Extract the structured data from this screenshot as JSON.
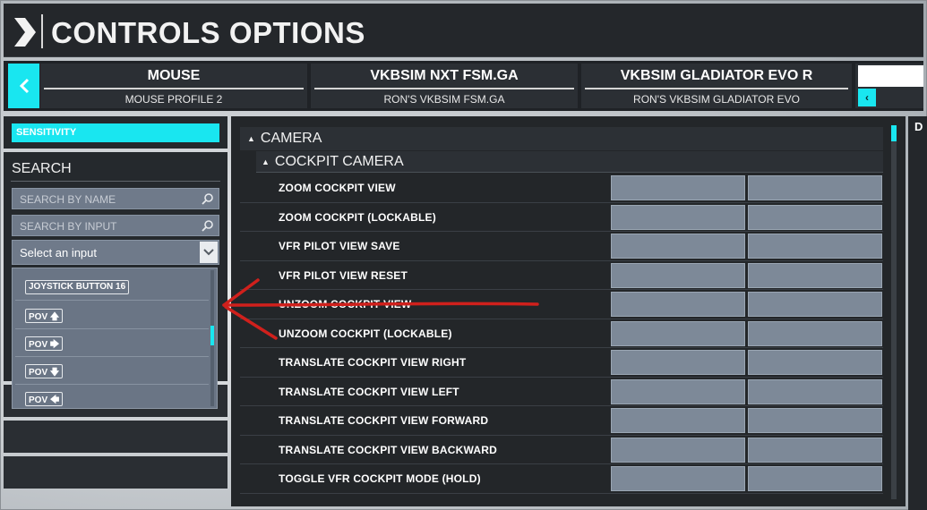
{
  "header": {
    "title": "CONTROLS OPTIONS",
    "back_icon": "chevron-right-icon"
  },
  "devices": [
    {
      "name": "MOUSE",
      "profile": "MOUSE PROFILE 2"
    },
    {
      "name": "VKBSIM NXT FSM.GA",
      "profile": "RON'S VKBSIM FSM.GA"
    },
    {
      "name": "VKBSIM GLADIATOR EVO R",
      "profile": "RON'S VKBSIM GLADIATOR EVO"
    }
  ],
  "devbar": {
    "prev_icon": "chevron-left-icon"
  },
  "left": {
    "sensitivity_label": "SENSITIVITY",
    "search_label": "SEARCH",
    "search_by_name_placeholder": "SEARCH BY NAME",
    "search_by_input_placeholder": "SEARCH BY INPUT",
    "select_input_value": "Select an input"
  },
  "dropdown": {
    "items": [
      {
        "label": "JOYSTICK BUTTON 16"
      },
      {
        "label": "POV 🡅"
      },
      {
        "label": "POV 🡆"
      },
      {
        "label": "POV 🡇"
      },
      {
        "label": "POV 🡄"
      }
    ]
  },
  "main": {
    "category": "CAMERA",
    "subcategory": "COCKPIT CAMERA",
    "rows": [
      {
        "label": "ZOOM COCKPIT VIEW"
      },
      {
        "label": "ZOOM COCKPIT (LOCKABLE)"
      },
      {
        "label": "VFR PILOT VIEW SAVE"
      },
      {
        "label": "VFR PILOT VIEW RESET"
      },
      {
        "label": "UNZOOM COCKPIT VIEW"
      },
      {
        "label": "UNZOOM COCKPIT (LOCKABLE)"
      },
      {
        "label": "TRANSLATE COCKPIT VIEW RIGHT"
      },
      {
        "label": "TRANSLATE COCKPIT VIEW LEFT"
      },
      {
        "label": "TRANSLATE COCKPIT VIEW FORWARD"
      },
      {
        "label": "TRANSLATE COCKPIT VIEW BACKWARD"
      },
      {
        "label": "TOGGLE VFR COCKPIT MODE (HOLD)"
      }
    ]
  },
  "right_panel": {
    "initial": "D"
  },
  "colors": {
    "accent": "#19e6f0",
    "annotation": "#d0201c"
  }
}
